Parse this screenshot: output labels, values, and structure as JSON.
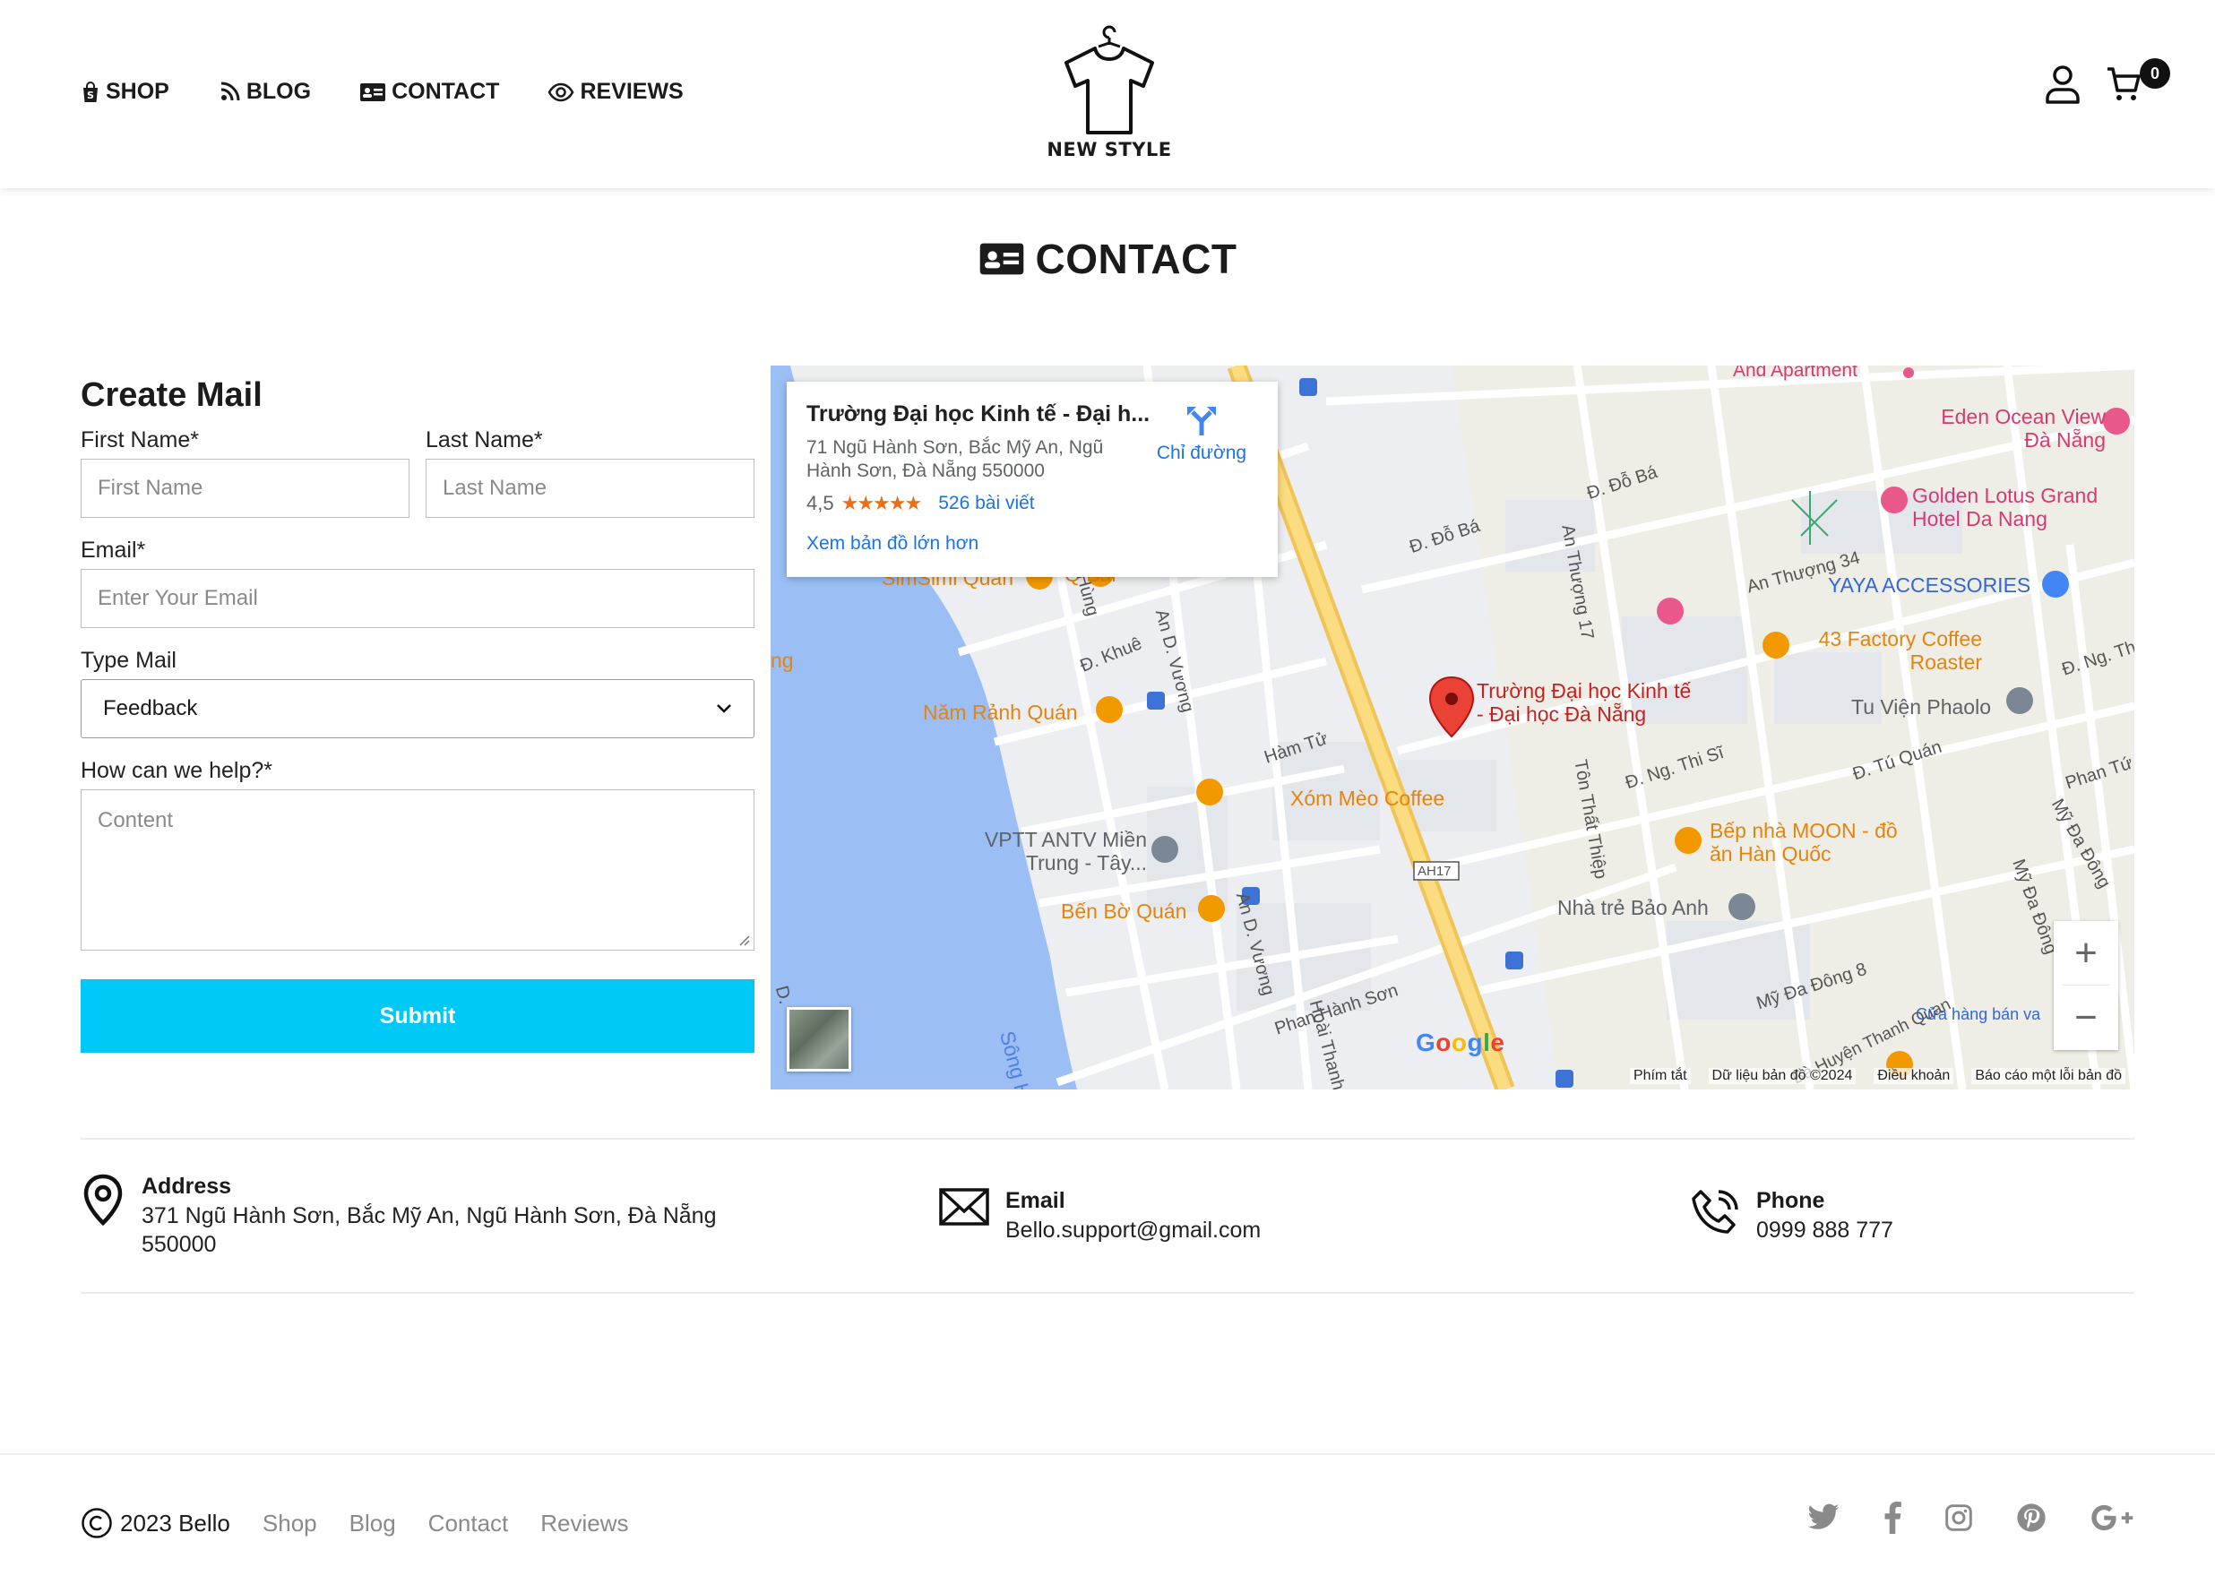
{
  "header": {
    "nav": [
      {
        "label": "SHOP",
        "icon": "shopify-bag-icon"
      },
      {
        "label": "BLOG",
        "icon": "blog-icon"
      },
      {
        "label": "CONTACT",
        "icon": "contact-card-icon"
      },
      {
        "label": "REVIEWS",
        "icon": "eye-icon"
      }
    ],
    "logo_text": "NEW STYLE",
    "cart_count": "0"
  },
  "page": {
    "title": "CONTACT"
  },
  "form": {
    "heading": "Create Mail",
    "first_name_label": "First Name*",
    "first_name_placeholder": "First Name",
    "last_name_label": "Last Name*",
    "last_name_placeholder": "Last Name",
    "email_label": "Email*",
    "email_placeholder": "Enter Your Email",
    "type_label": "Type Mail",
    "type_value": "Feedback",
    "help_label": "How can we help?*",
    "help_placeholder": "Content",
    "submit_label": "Submit",
    "accent_color": "#00c9f7"
  },
  "map": {
    "place_name": "Trường Đại học Kinh tế - Đại h...",
    "place_address": "71 Ngũ Hành Sơn, Bắc Mỹ An, Ngũ Hành Sơn, Đà Nẵng 550000",
    "rating": "4,5",
    "reviews": "526 bài viết",
    "view_larger": "Xem bản đồ lớn hơn",
    "directions": "Chỉ đường",
    "labels": {
      "marker": "Trường Đại học Kinh tế - Đại học Đà Nẵng",
      "simsimi": "SimSimi Quán",
      "qbar": "Q Bar",
      "nam_ranh": "Năm Rảnh Quán",
      "vptt": "VPTT ANTV Miền Trung - Tây...",
      "ben_bo": "Bến Bờ Quán",
      "song": "Sông Hàn",
      "xom_meo": "Xóm Mèo Coffee",
      "eden": "Eden Ocean View Đà Nẵng",
      "golden_lotus": "Golden Lotus Grand Hotel Da Nang",
      "yaya": "YAYA ACCESSORIES",
      "factory": "43 Factory Coffee Roaster",
      "tu_vien": "Tu Viện Phaolo",
      "bep_nha": "Bếp nhà MOON - đồ ăn Hàn Quốc",
      "nha_tre": "Nhà trẻ Bảo Anh",
      "cua_hang": "Cửa hàng bán va",
      "apartment": "And Apartment",
      "ham_tu": "Hàm Tử",
      "phan_hanh_son": "Phan Hành Sơn",
      "an_thuong_34": "An Thượng 34",
      "an_thuong_17": "An Thượng 17",
      "do_ba": "Đ. Đỗ Bá",
      "do_ba2": "Đ. Đỗ Bá",
      "ng_thi_si": "Đ. Ng. Thi Sĩ",
      "tu_quan": "Đ. Tú Quán",
      "ton_that_thiep": "Tôn Thất Thiệp",
      "an_d_vuong": "An D. Vương",
      "an_d_vuong2": "An D. Vương",
      "khue": "Đ. Khuê",
      "my_da_dong_8": "Mỹ Đa Đông 8",
      "ba_huyen": "Bà Huyện Thanh Quan",
      "ah17": "AH17",
      "hoai_thanh": "Hoài Thanh",
      "phan_tu": "Phan Tứ",
      "ng_th": "Đ. Ng. Th",
      "my_da_dong_cut": "Mỹ Đa Đông",
      "my_da_dong_cut2": "Mỹ Đa Đông",
      "ng_hanh": "ng",
      "d_label": "D.",
      "hung": "Hùng"
    },
    "footer": [
      "Phím tắt",
      "Dữ liệu bản đồ ©2024",
      "Điều khoản",
      "Báo cáo một lỗi bản đồ"
    ],
    "google": "Google"
  },
  "contact": {
    "address_title": "Address",
    "address_value": "371 Ngũ Hành Sơn, Bắc Mỹ An, Ngũ Hành Sơn, Đà Nẵng 550000",
    "email_title": "Email",
    "email_value": "Bello.support@gmail.com",
    "phone_title": "Phone",
    "phone_value": "0999 888 777"
  },
  "footer": {
    "copyright": "2023 Bello",
    "links": [
      "Shop",
      "Blog",
      "Contact",
      "Reviews"
    ],
    "social": [
      "twitter-icon",
      "facebook-icon",
      "instagram-icon",
      "pinterest-icon",
      "google-plus-icon"
    ]
  }
}
